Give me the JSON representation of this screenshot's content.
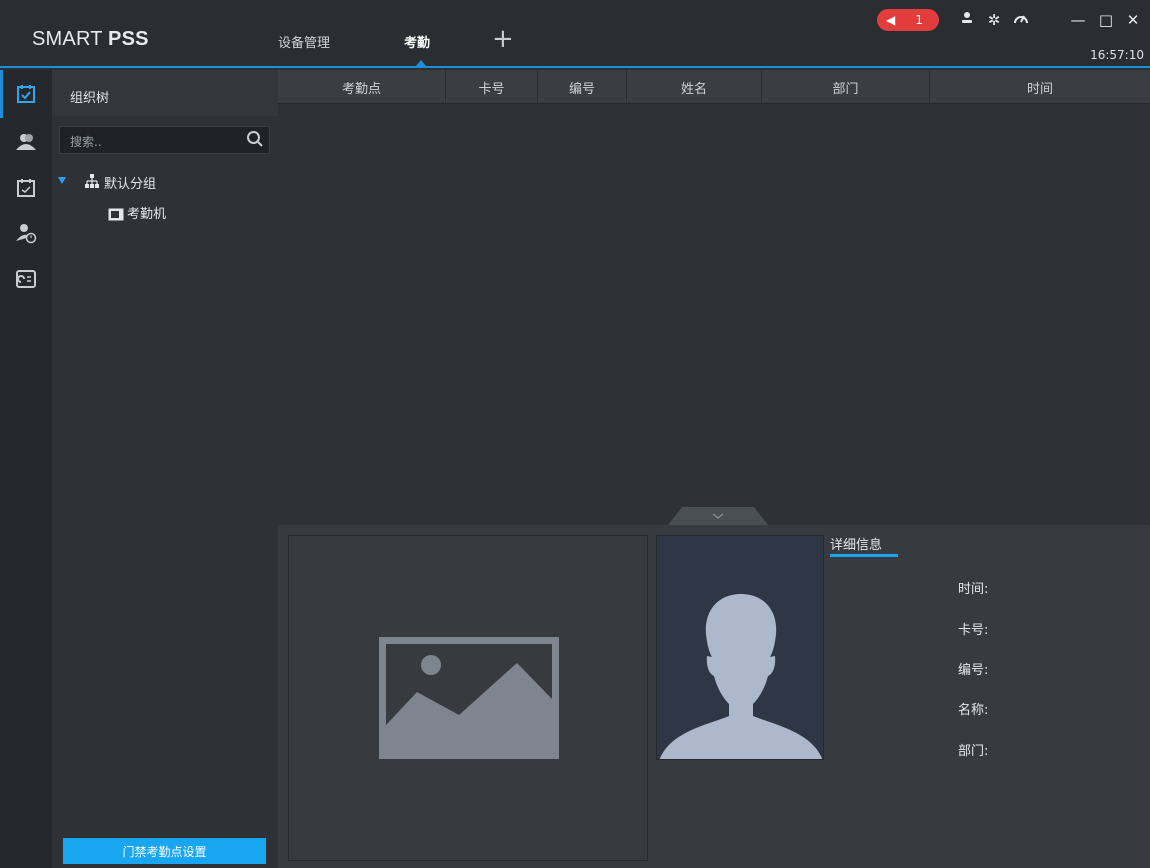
{
  "app": {
    "logo_light": "SMART ",
    "logo_bold": "PSS",
    "clock": "16:57:10"
  },
  "tabs": [
    {
      "label": "设备管理"
    },
    {
      "label": "考勤"
    }
  ],
  "alarm": {
    "count": "1"
  },
  "window_controls": {
    "minimize": "—",
    "maximize": "□",
    "close": "✕"
  },
  "sidebar": {
    "title": "组织树",
    "search_placeholder": "搜索..",
    "tree": {
      "group": "默认分组",
      "device": "考勤机"
    },
    "config_button": "门禁考勤点设置"
  },
  "table": {
    "columns": [
      "考勤点",
      "卡号",
      "编号",
      "姓名",
      "部门",
      "时间"
    ]
  },
  "details": {
    "title": "详细信息",
    "fields": [
      "时间:",
      "卡号:",
      "编号:",
      "名称:",
      "部门:"
    ]
  },
  "colors": {
    "accent": "#19a6f0",
    "alarm": "#e23c3c",
    "background": "#2e3136"
  }
}
